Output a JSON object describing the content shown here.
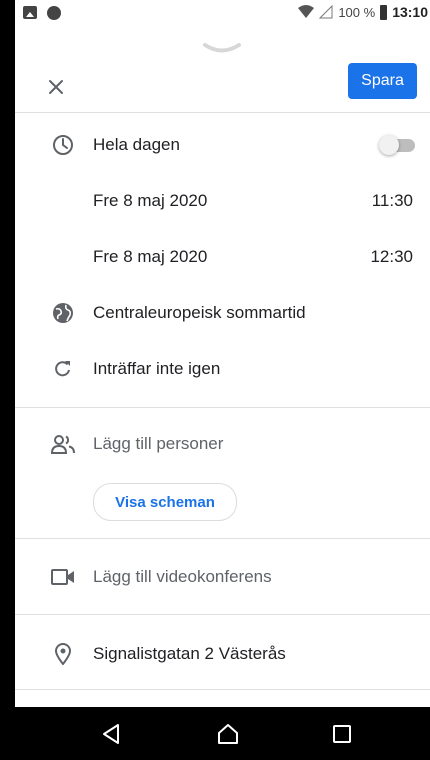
{
  "status_bar": {
    "battery_percent": "100 %",
    "time": "13:10",
    "icons": [
      "image-icon",
      "globe-icon",
      "wifi-icon",
      "signal-icon",
      "battery-icon"
    ]
  },
  "header": {
    "save_label": "Spara",
    "close_icon": "close-icon"
  },
  "event": {
    "all_day_label": "Hela dagen",
    "all_day_enabled": false,
    "start": {
      "date": "Fre 8 maj 2020",
      "time": "11:30"
    },
    "end": {
      "date": "Fre 8 maj 2020",
      "time": "12:30"
    },
    "timezone": "Centraleuropeisk sommartid",
    "repeat": "Inträffar inte igen",
    "people_label": "Lägg till personer",
    "schedule_button": "Visa scheman",
    "video_label": "Lägg till videokonferens",
    "location": "Signalistgatan 2 Västerås"
  },
  "colors": {
    "accent": "#1a73e8",
    "icon": "#5f6368",
    "divider": "#e0e0e0"
  }
}
